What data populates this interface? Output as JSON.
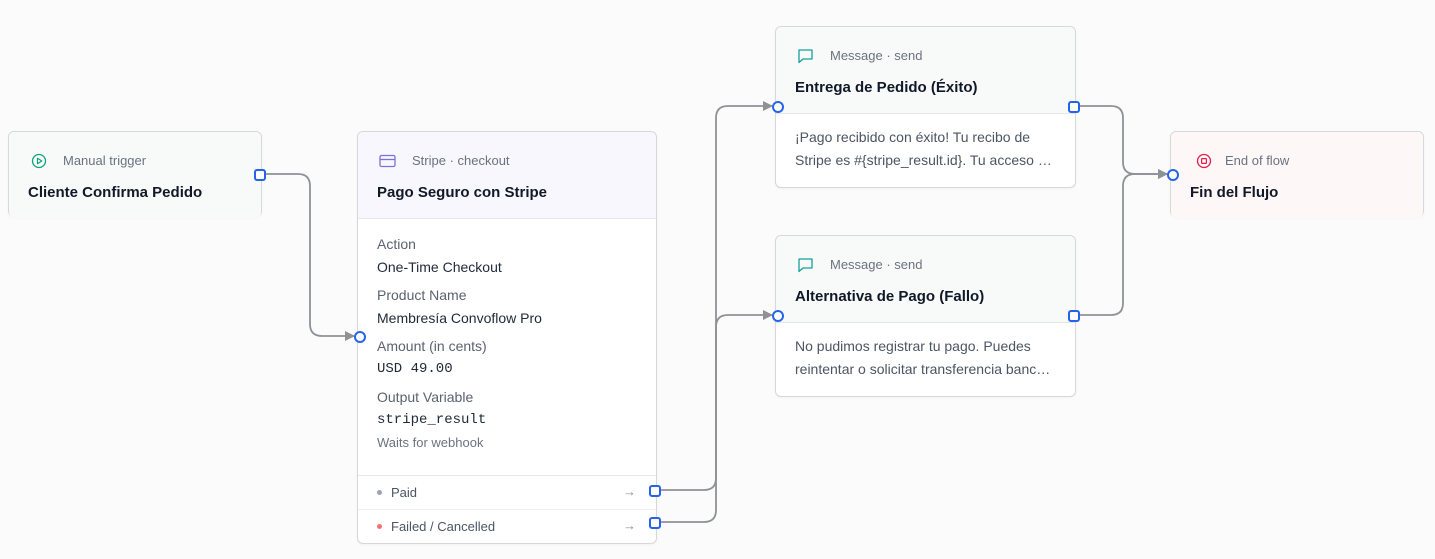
{
  "nodes": {
    "trigger": {
      "kind": "Manual trigger",
      "title": "Cliente Confirma Pedido",
      "icon": "play-circle-icon",
      "icon_color": "#10a37f"
    },
    "stripe": {
      "kind": "Stripe · checkout",
      "title": "Pago Seguro con Stripe",
      "icon": "credit-card-icon",
      "icon_color": "#7c6fe0",
      "fields": [
        {
          "label": "Action",
          "value": "One-Time Checkout"
        },
        {
          "label": "Product Name",
          "value": "Membresía Convoflow Pro"
        },
        {
          "label": "Amount (in cents)",
          "value": "USD 49.00"
        },
        {
          "label": "Output Variable",
          "value": "stripe_result"
        }
      ],
      "note": "Waits for webhook",
      "branches": [
        {
          "label": "Paid",
          "dot_color": "#9ca3af"
        },
        {
          "label": "Failed / Cancelled",
          "dot_color": "#f87171"
        }
      ]
    },
    "success": {
      "kind": "Message · send",
      "title": "Entrega de Pedido (Éxito)",
      "icon": "message-icon",
      "icon_color": "#14a19a",
      "text_line1": "¡Pago recibido con éxito! Tu recibo de",
      "text_line2": "Stripe es #{stripe_result.id}. Tu acceso ya está activo."
    },
    "failure": {
      "kind": "Message · send",
      "title": "Alternativa de Pago (Fallo)",
      "icon": "message-icon",
      "icon_color": "#14a19a",
      "text_line1": "No pudimos registrar tu pago. Puedes",
      "text_line2": "reintentar o solicitar transferencia bancaria."
    },
    "end": {
      "kind": "End of flow",
      "title": "Fin del Flujo",
      "icon": "stop-circle-icon",
      "icon_color": "#e11d48"
    }
  },
  "colors": {
    "port": "#2563eb",
    "edge": "#8e9196"
  }
}
